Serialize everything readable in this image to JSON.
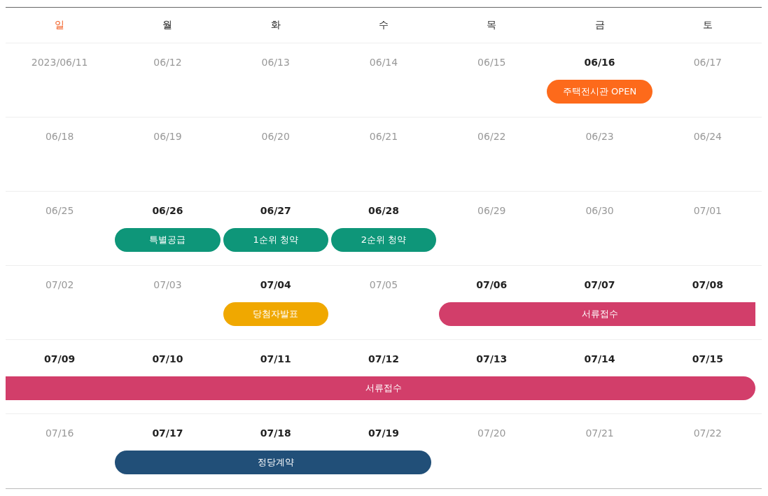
{
  "weekdays": [
    {
      "label": "일",
      "holiday": true
    },
    {
      "label": "월",
      "holiday": false
    },
    {
      "label": "화",
      "holiday": false
    },
    {
      "label": "수",
      "holiday": false
    },
    {
      "label": "목",
      "holiday": false
    },
    {
      "label": "금",
      "holiday": false
    },
    {
      "label": "토",
      "holiday": false
    }
  ],
  "weeks": [
    {
      "days": [
        {
          "date": "2023/06/11",
          "highlight": false
        },
        {
          "date": "06/12",
          "highlight": false
        },
        {
          "date": "06/13",
          "highlight": false
        },
        {
          "date": "06/14",
          "highlight": false
        },
        {
          "date": "06/15",
          "highlight": false
        },
        {
          "date": "06/16",
          "highlight": true,
          "bar": {
            "kind": "single",
            "color": "#fd6a1b",
            "label": "주택전시관 OPEN"
          }
        },
        {
          "date": "06/17",
          "highlight": false
        }
      ]
    },
    {
      "days": [
        {
          "date": "06/18",
          "highlight": false
        },
        {
          "date": "06/19",
          "highlight": false
        },
        {
          "date": "06/20",
          "highlight": false
        },
        {
          "date": "06/21",
          "highlight": false
        },
        {
          "date": "06/22",
          "highlight": false
        },
        {
          "date": "06/23",
          "highlight": false
        },
        {
          "date": "06/24",
          "highlight": false
        }
      ]
    },
    {
      "days": [
        {
          "date": "06/25",
          "highlight": false
        },
        {
          "date": "06/26",
          "highlight": true,
          "bar": {
            "kind": "single",
            "color": "#0e9679",
            "label": "특별공급"
          }
        },
        {
          "date": "06/27",
          "highlight": true,
          "bar": {
            "kind": "single",
            "color": "#0e9679",
            "label": "1순위 청약"
          }
        },
        {
          "date": "06/28",
          "highlight": true,
          "bar": {
            "kind": "single",
            "color": "#0e9679",
            "label": "2순위 청약"
          }
        },
        {
          "date": "06/29",
          "highlight": false
        },
        {
          "date": "06/30",
          "highlight": false
        },
        {
          "date": "07/01",
          "highlight": false
        }
      ]
    },
    {
      "days": [
        {
          "date": "07/02",
          "highlight": false
        },
        {
          "date": "07/03",
          "highlight": false
        },
        {
          "date": "07/04",
          "highlight": true,
          "bar": {
            "kind": "single",
            "color": "#f0a800",
            "label": "당첨자발표"
          }
        },
        {
          "date": "07/05",
          "highlight": false
        },
        {
          "date": "07/06",
          "highlight": true,
          "bar": {
            "kind": "start",
            "color": "#d23e6a",
            "label": "서류접수"
          }
        },
        {
          "date": "07/07",
          "highlight": true,
          "bar": {
            "kind": "middle",
            "color": "#d23e6a"
          }
        },
        {
          "date": "07/08",
          "highlight": true,
          "bar": {
            "kind": "middle",
            "color": "#d23e6a"
          }
        }
      ]
    },
    {
      "days": [
        {
          "date": "07/09",
          "highlight": true,
          "bar": {
            "kind": "middle",
            "color": "#d23e6a",
            "label": "서류접수"
          }
        },
        {
          "date": "07/10",
          "highlight": true,
          "bar": {
            "kind": "middle",
            "color": "#d23e6a"
          }
        },
        {
          "date": "07/11",
          "highlight": true,
          "bar": {
            "kind": "middle",
            "color": "#d23e6a"
          }
        },
        {
          "date": "07/12",
          "highlight": true,
          "bar": {
            "kind": "middle",
            "color": "#d23e6a"
          }
        },
        {
          "date": "07/13",
          "highlight": true,
          "bar": {
            "kind": "middle",
            "color": "#d23e6a"
          }
        },
        {
          "date": "07/14",
          "highlight": true,
          "bar": {
            "kind": "middle",
            "color": "#d23e6a"
          }
        },
        {
          "date": "07/15",
          "highlight": true,
          "bar": {
            "kind": "end",
            "color": "#d23e6a"
          }
        }
      ]
    },
    {
      "days": [
        {
          "date": "07/16",
          "highlight": false
        },
        {
          "date": "07/17",
          "highlight": true,
          "bar": {
            "kind": "start",
            "color": "#214f78",
            "label": "정당계약"
          }
        },
        {
          "date": "07/18",
          "highlight": true,
          "bar": {
            "kind": "middle",
            "color": "#214f78"
          }
        },
        {
          "date": "07/19",
          "highlight": true,
          "bar": {
            "kind": "end",
            "color": "#214f78"
          }
        },
        {
          "date": "07/20",
          "highlight": false
        },
        {
          "date": "07/21",
          "highlight": false
        },
        {
          "date": "07/22",
          "highlight": false
        }
      ]
    }
  ]
}
